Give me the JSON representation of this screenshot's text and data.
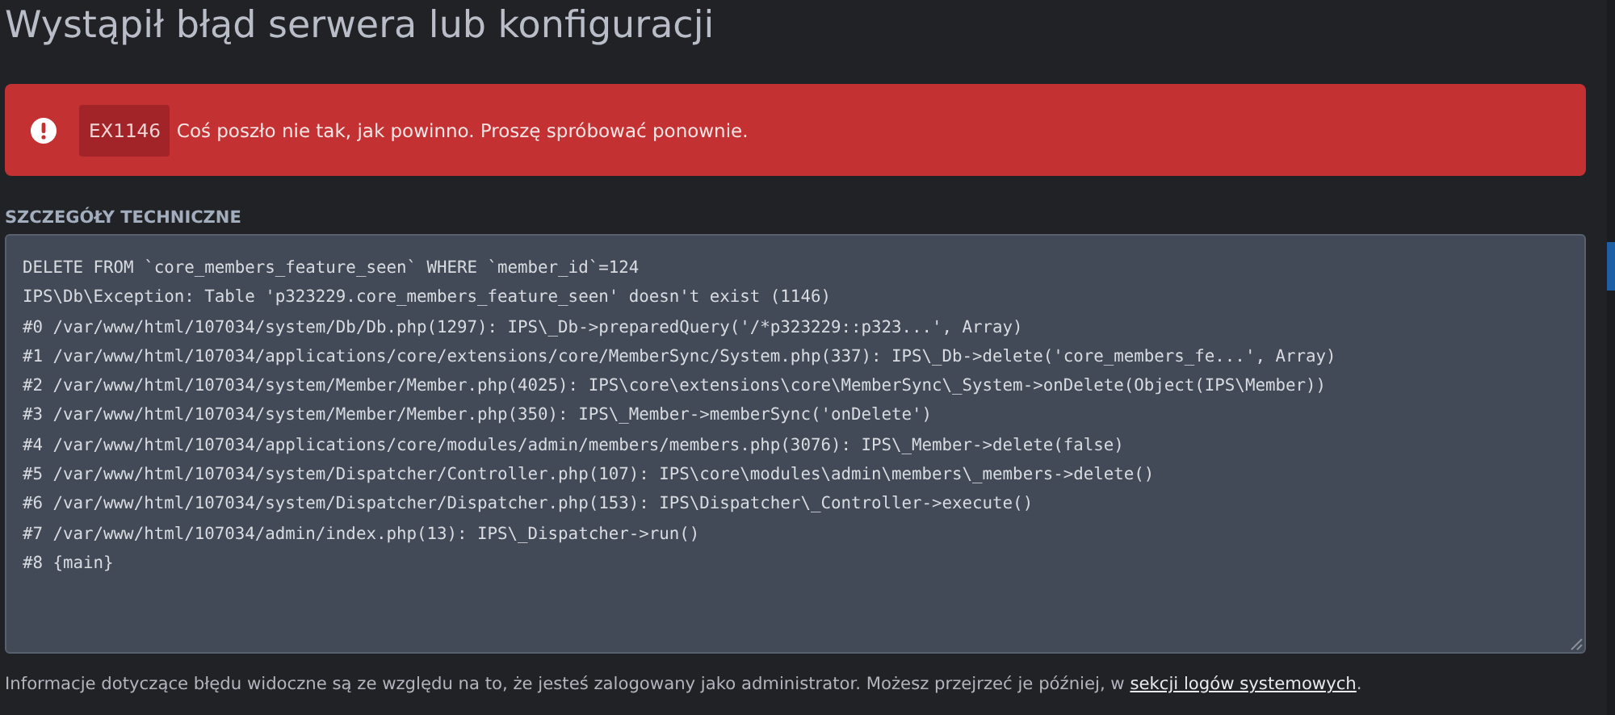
{
  "title": "Wystąpił błąd serwera lub konfiguracji",
  "alert": {
    "code": "EX1146",
    "message": "Coś poszło nie tak, jak powinno. Proszę spróbować ponownie."
  },
  "details": {
    "label": "SZCZEGÓŁY TECHNICZNE",
    "lines": [
      "DELETE FROM `core_members_feature_seen` WHERE `member_id`=124",
      "IPS\\Db\\Exception: Table 'p323229.core_members_feature_seen' doesn't exist (1146)",
      "#0 /var/www/html/107034/system/Db/Db.php(1297): IPS\\_Db->preparedQuery('/*p323229::p323...', Array)",
      "#1 /var/www/html/107034/applications/core/extensions/core/MemberSync/System.php(337): IPS\\_Db->delete('core_members_fe...', Array)",
      "#2 /var/www/html/107034/system/Member/Member.php(4025): IPS\\core\\extensions\\core\\MemberSync\\_System->onDelete(Object(IPS\\Member))",
      "#3 /var/www/html/107034/system/Member/Member.php(350): IPS\\_Member->memberSync('onDelete')",
      "#4 /var/www/html/107034/applications/core/modules/admin/members/members.php(3076): IPS\\_Member->delete(false)",
      "#5 /var/www/html/107034/system/Dispatcher/Controller.php(107): IPS\\core\\modules\\admin\\members\\_members->delete()",
      "#6 /var/www/html/107034/system/Dispatcher/Dispatcher.php(153): IPS\\Dispatcher\\_Controller->execute()",
      "#7 /var/www/html/107034/admin/index.php(13): IPS\\_Dispatcher->run()",
      "#8 {main}"
    ]
  },
  "footer": {
    "text": "Informacje dotyczące błędu widoczne są ze względu na to, że jesteś zalogowany jako administrator. Możesz przejrzeć je później, w ",
    "link": "sekcji logów systemowych",
    "end": "."
  }
}
